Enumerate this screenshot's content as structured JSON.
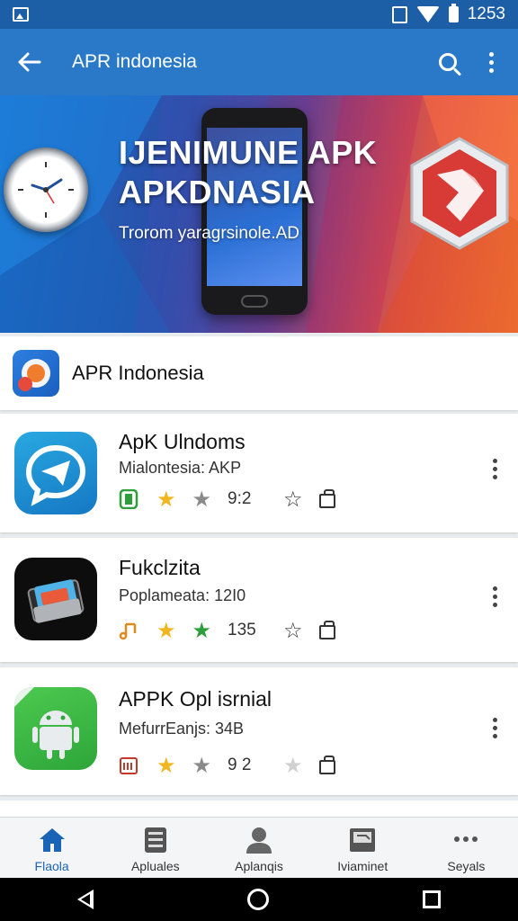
{
  "status_bar": {
    "time": "1253"
  },
  "app_bar": {
    "title": "APR indonesia"
  },
  "banner": {
    "title_line1": "IJENIMUNE APK",
    "title_line2": "APKDNASIA",
    "subtitle": "Trorom yaragrsinole.AD"
  },
  "section": {
    "title": "APR Indonesia"
  },
  "apps": [
    {
      "name": "ApK Ulndoms",
      "desc": "Mialontesia: AKP",
      "count": "9:2",
      "second_star_color": "#8a8a8a",
      "outline_star_color": "#333333"
    },
    {
      "name": "Fukclzita",
      "desc": "Poplameata: 12I0",
      "count": "135",
      "second_star_color": "#2e9e3a",
      "outline_star_color": "#333333"
    },
    {
      "name": "APPK Opl isrnial",
      "desc": "MefurrEanjs: 34B",
      "count": "9 2",
      "second_star_color": "#8a8a8a",
      "outline_star_color": "#d0d0d0"
    }
  ],
  "bottom_nav": [
    {
      "label": "Flaola",
      "active": true
    },
    {
      "label": "Apluales",
      "active": false
    },
    {
      "label": "Aplanqis",
      "active": false
    },
    {
      "label": "Iviaminet",
      "active": false
    },
    {
      "label": "Seyals",
      "active": false
    }
  ],
  "colors": {
    "primary": "#2979c8",
    "status": "#1c5fa6",
    "star_gold": "#f2b51b",
    "accent_nav": "#1a64b8"
  }
}
